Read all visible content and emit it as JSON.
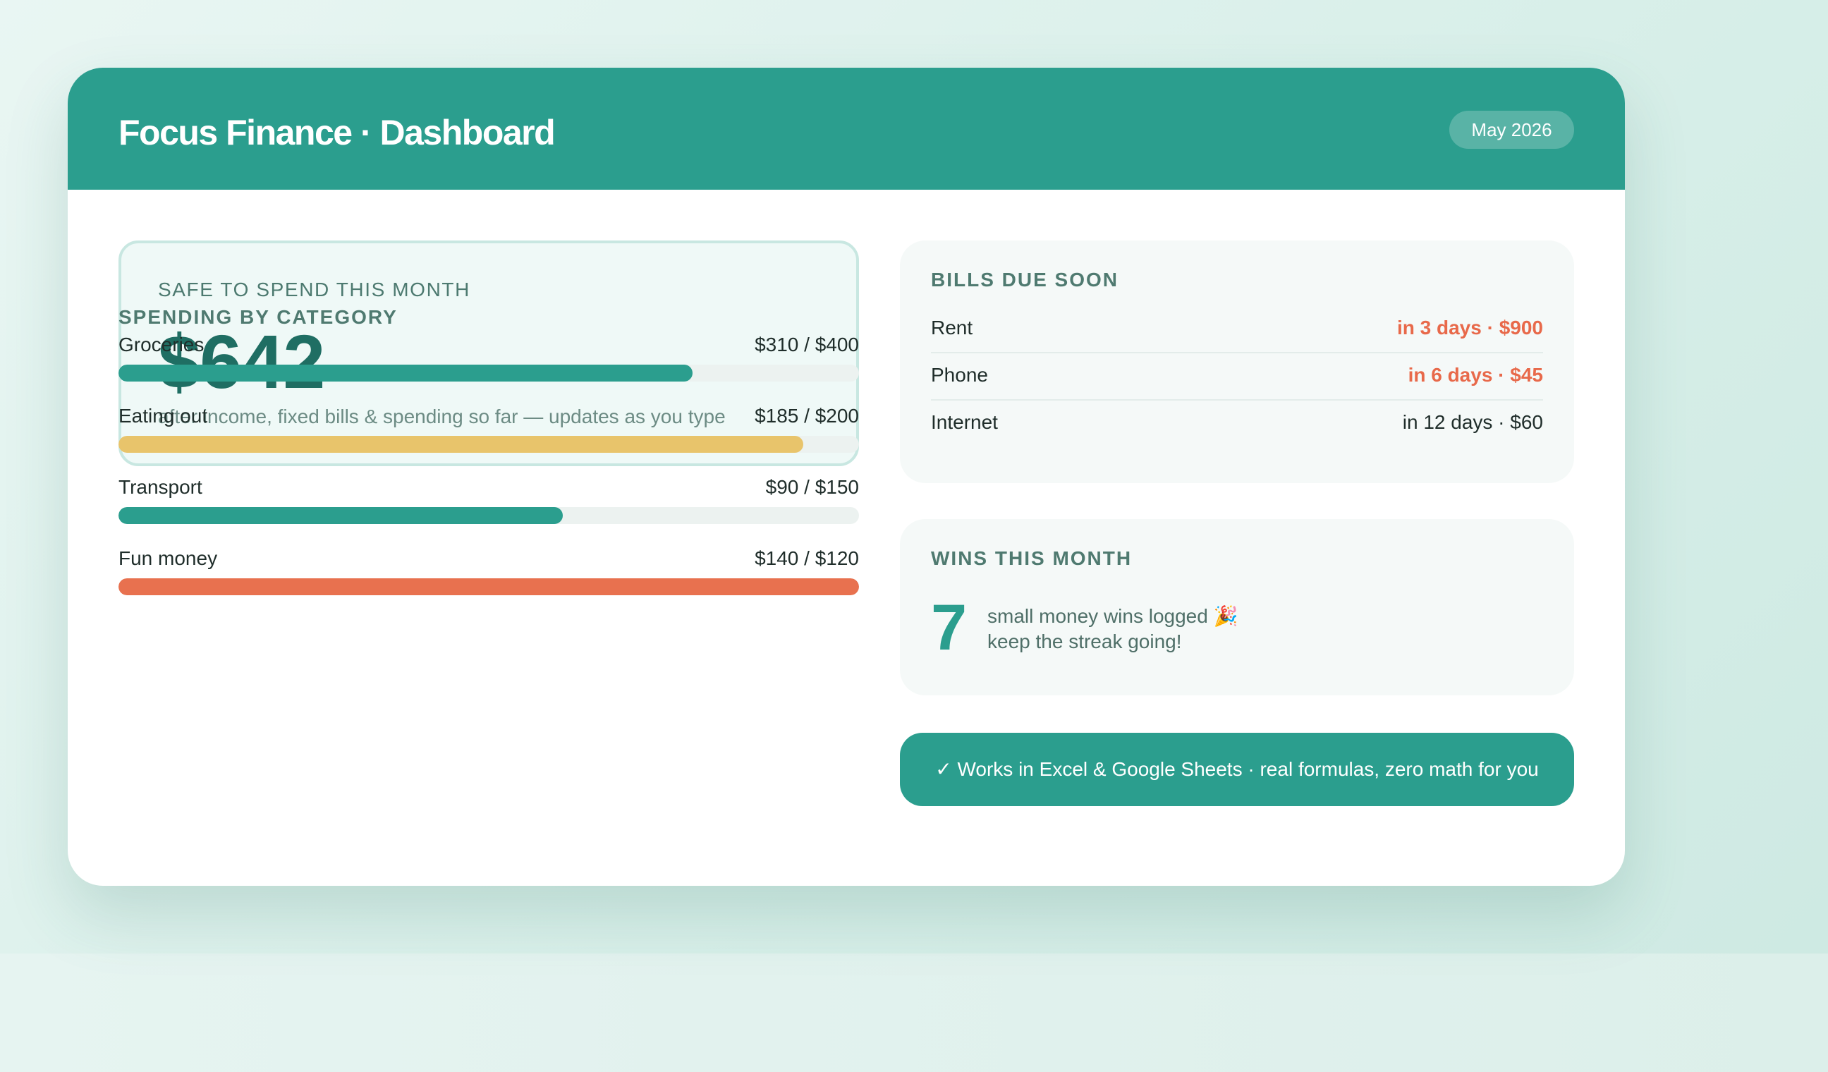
{
  "app": {
    "title": "Focus Finance · Dashboard",
    "month": "May 2026"
  },
  "safe_to_spend": {
    "label": "SAFE TO SPEND THIS MONTH",
    "amount": "$642",
    "note": "after income, fixed bills & spending so far — updates as you type"
  },
  "spending": {
    "title": "SPENDING BY CATEGORY",
    "items": [
      {
        "name": "Groceries",
        "amount": "$310 / $400",
        "spent": 310,
        "budget": 400,
        "color": "#2b9e8e"
      },
      {
        "name": "Eating out",
        "amount": "$185 / $200",
        "spent": 185,
        "budget": 200,
        "color": "#e8c46b"
      },
      {
        "name": "Transport",
        "amount": "$90 / $150",
        "spent": 90,
        "budget": 150,
        "color": "#2b9e8e"
      },
      {
        "name": "Fun money",
        "amount": "$140 / $120",
        "spent": 140,
        "budget": 120,
        "color": "#e8714f"
      }
    ]
  },
  "bills": {
    "title": "BILLS DUE SOON",
    "items": [
      {
        "name": "Rent",
        "due": "in 3 days · $900",
        "urgent": true
      },
      {
        "name": "Phone",
        "due": "in 6 days · $45",
        "urgent": true
      },
      {
        "name": "Internet",
        "due": "in 12 days · $60",
        "urgent": false
      }
    ]
  },
  "wins": {
    "title": "WINS THIS MONTH",
    "count": "7",
    "line1": "small money wins logged 🎉",
    "line2": "keep the streak going!"
  },
  "cta": {
    "label": "✓ Works in Excel & Google Sheets · real formulas, zero math for you"
  },
  "colors": {
    "accent": "#2b9e8e",
    "warning": "#e8c46b",
    "over_budget": "#e8714f",
    "urgent": "#e8694a"
  }
}
